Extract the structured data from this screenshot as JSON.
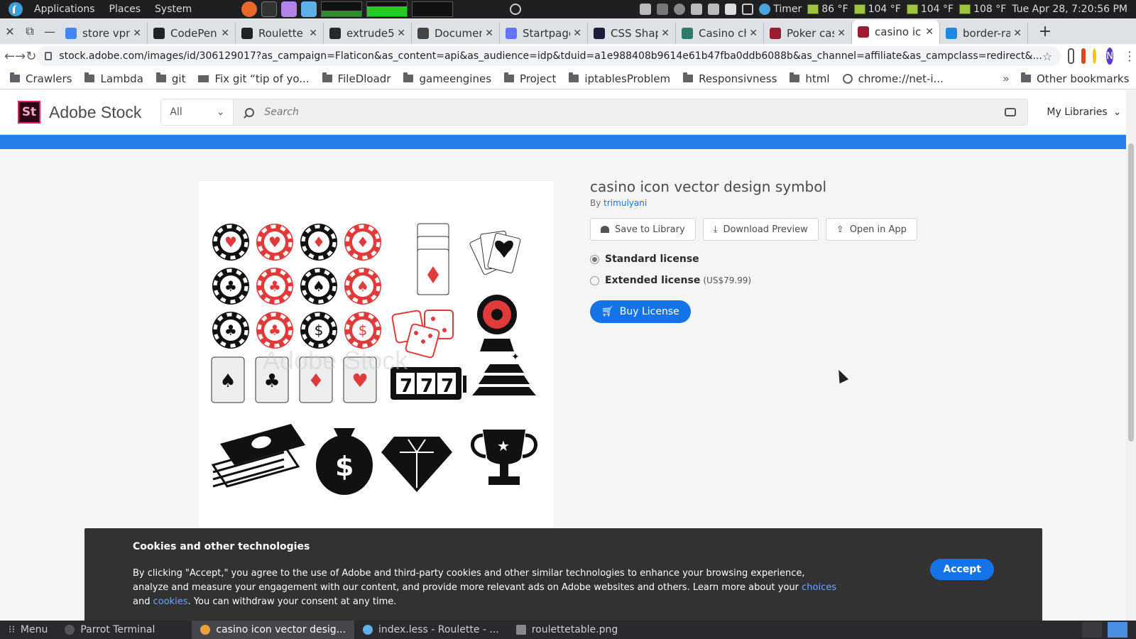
{
  "system_bar": {
    "menus": [
      "Applications",
      "Places",
      "System"
    ],
    "timer_label": "Timer",
    "temps": [
      "86 °F",
      "104 °F",
      "104 °F",
      "108 °F"
    ],
    "clock": "Tue Apr 28, 7:20:56 PM"
  },
  "tabs": [
    {
      "title": "store vpn",
      "color": "#4285f4"
    },
    {
      "title": "CodePen",
      "color": "#222222"
    },
    {
      "title": "Roulette",
      "color": "#222222"
    },
    {
      "title": "extrude5",
      "color": "#24292e"
    },
    {
      "title": "Documen",
      "color": "#444444"
    },
    {
      "title": "Startpage",
      "color": "#6573ff"
    },
    {
      "title": "CSS Shap",
      "color": "#1d1d3a"
    },
    {
      "title": "Casino ch",
      "color": "#2c7b6b"
    },
    {
      "title": "Poker cas",
      "color": "#9b1b30"
    },
    {
      "title": "casino ic",
      "color": "#9b1b30",
      "active": true
    },
    {
      "title": "border-ra",
      "color": "#1e88e5"
    }
  ],
  "omnibox": {
    "url": "stock.adobe.com/images/id/306129017?as_campaign=Flaticon&as_content=api&as_audience=idp&tduid=a1e988408b9614e61b47fba0ddb6088b&as_channel=affiliate&as_campclass=redirect&..."
  },
  "bookmarks": [
    {
      "label": "Crawlers",
      "icon": "folder"
    },
    {
      "label": "Lambda",
      "icon": "folder"
    },
    {
      "label": "git",
      "icon": "folder"
    },
    {
      "label": "Fix git “tip of yo...",
      "icon": "laptop"
    },
    {
      "label": "FileDloadr",
      "icon": "folder"
    },
    {
      "label": "gameengines",
      "icon": "folder"
    },
    {
      "label": "Project",
      "icon": "folder"
    },
    {
      "label": "iptablesProblem",
      "icon": "folder"
    },
    {
      "label": "Responsivness",
      "icon": "folder"
    },
    {
      "label": "html",
      "icon": "folder"
    },
    {
      "label": "chrome://net-i...",
      "icon": "globe"
    }
  ],
  "bookmarks_other": "Other bookmarks",
  "bookmarks_more": "»",
  "stock": {
    "logo": "St",
    "brand": "Adobe Stock",
    "filter": "All",
    "search_placeholder": "Search",
    "my_libraries": "My Libraries",
    "image_id": "#306129017",
    "watermark": "Adobe Stock",
    "title": "casino icon vector design symbol",
    "by": "By",
    "author": "trimulyani",
    "save_to_library": "Save to Library",
    "download_preview": "Download Preview",
    "open_in_app": "Open in App",
    "standard_license": "Standard license",
    "extended_license": "Extended license",
    "extended_price": "(US$79.99)",
    "buy_license": "Buy License"
  },
  "cookie": {
    "title": "Cookies and other technologies",
    "text_before": "By clicking \"Accept,\" you agree to the use of Adobe and third-party cookies and other similar technologies to enhance your browsing experience, analyze and measure your engagement with our content, and provide more relevant ads on Adobe websites and others. Learn more about your ",
    "link_choices": "choices",
    "text_and": " and ",
    "link_cookies": "cookies",
    "text_after": ". You can withdraw your consent at any time.",
    "accept": "Accept"
  },
  "taskbar": {
    "menu": "Menu",
    "items": [
      "Parrot Terminal",
      "casino icon vector desig...",
      "index.less - Roulette - ...",
      "roulettetable.png"
    ]
  },
  "colors": {
    "accent": "#1473e6",
    "blue_band": "#2680eb",
    "chip_red": "#e03a3a"
  }
}
